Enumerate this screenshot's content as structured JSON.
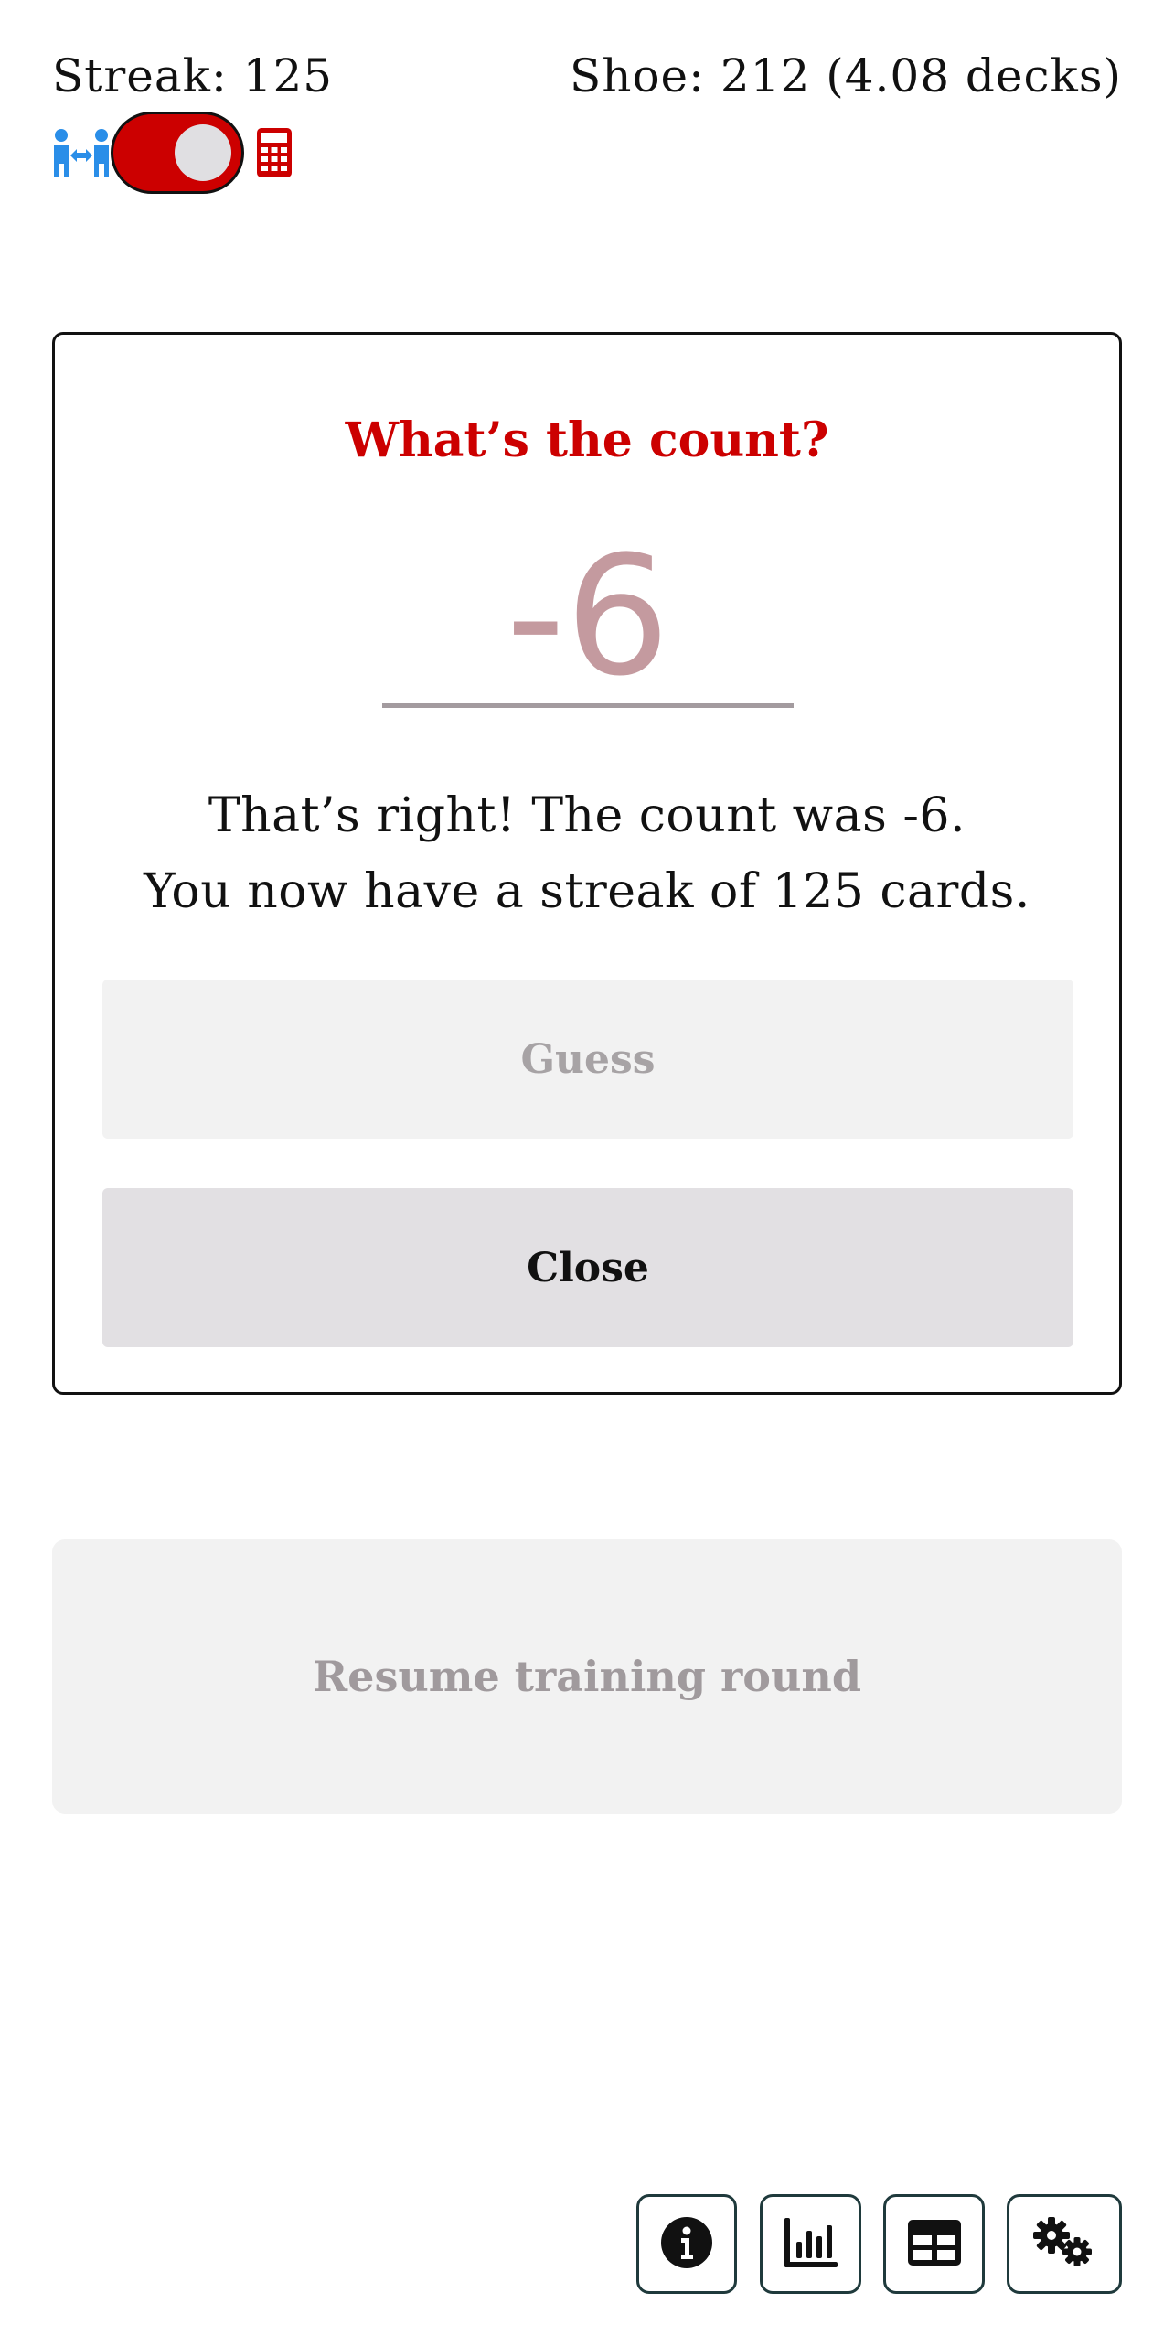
{
  "status": {
    "streak_text": "Streak: 125",
    "shoe_text": "Shoe: 212 (4.08 decks)"
  },
  "mode_toggle": {
    "left_icon": "people-arrows-icon",
    "right_icon": "calculator-icon",
    "state": "on",
    "active_color": "#cc0000",
    "left_icon_color": "#2a8ee8"
  },
  "modal": {
    "title": "What’s the count?",
    "input_value": "-6",
    "message_line1": "That’s right! The count was -6.",
    "message_line2": "You now have a streak of 125 cards.",
    "guess_label": "Guess",
    "close_label": "Close"
  },
  "resume_label": "Resume training round",
  "toolbar": {
    "icons": [
      "info-icon",
      "bar-chart-icon",
      "table-icon",
      "gears-icon"
    ]
  }
}
